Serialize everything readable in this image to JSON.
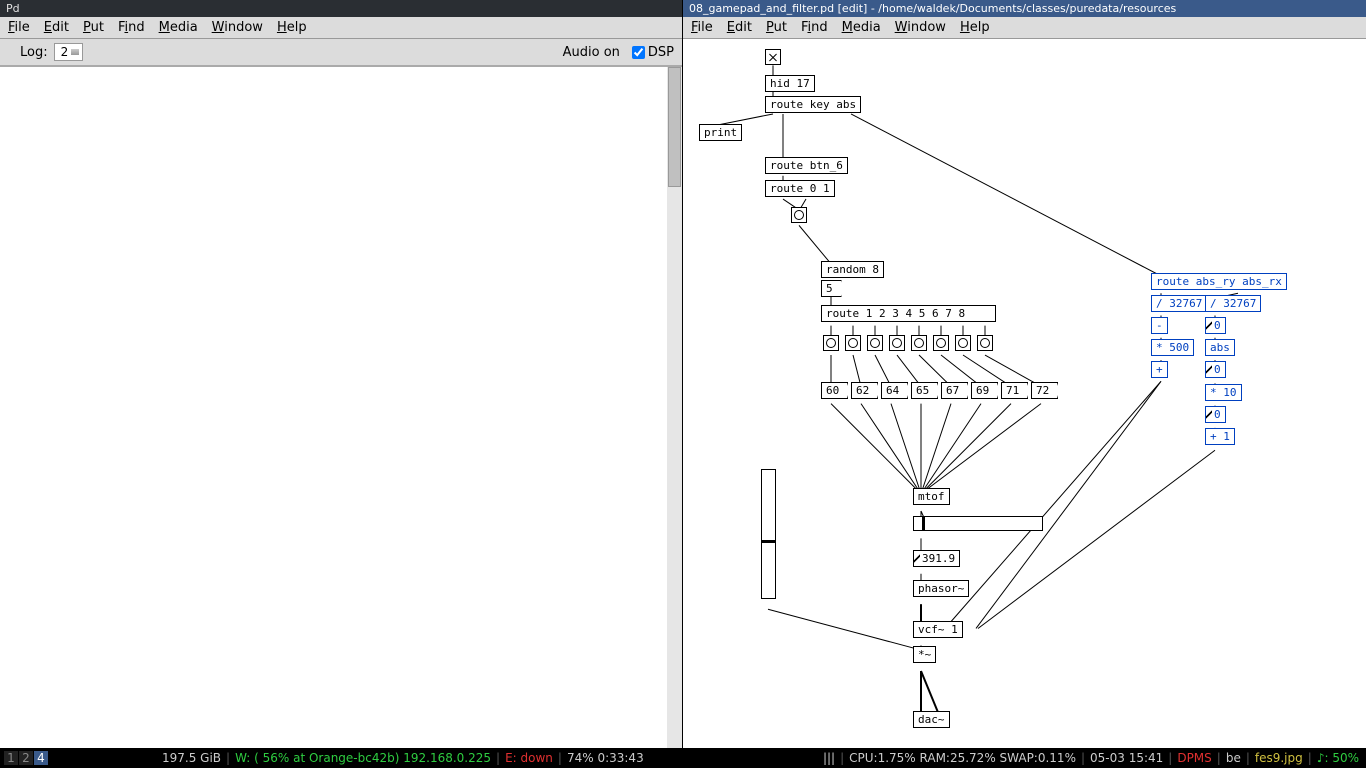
{
  "left_window": {
    "title": "Pd",
    "menu": [
      "File",
      "Edit",
      "Put",
      "Find",
      "Media",
      "Window",
      "Help"
    ],
    "log_label": "Log:",
    "log_value": "2",
    "audio_label": "Audio on",
    "dsp_label": "DSP"
  },
  "right_window": {
    "title": "08_gamepad_and_filter.pd  [edit] - /home/waldek/Documents/classes/puredata/resources",
    "menu": [
      "File",
      "Edit",
      "Put",
      "Find",
      "Media",
      "Window",
      "Help"
    ]
  },
  "patch": {
    "toggle_top": "",
    "hid": "hid 17",
    "route_key_abs": "route key abs",
    "print": "print",
    "route_btn6": "route btn_6",
    "route_01": "route 0 1",
    "random8": "random 8",
    "msg5": "5",
    "route_1to8": "route 1 2 3 4 5 6 7 8",
    "notes": [
      "60",
      "62",
      "64",
      "65",
      "67",
      "69",
      "71",
      "72"
    ],
    "mtof": "mtof",
    "freq_num": "391.9",
    "phasor": "phasor~",
    "vcf": "vcf~ 1",
    "mult_sig": "*~",
    "dac": "dac~",
    "route_abs_rxry": "route abs_ry abs_rx",
    "div_left": "/ 32767",
    "div_right": "/ 32767",
    "minus": "-",
    "zero1": "0",
    "mul500": "* 500",
    "abs_obj": "abs",
    "plus_empty": "+",
    "zero2": "0",
    "mul10": "* 10",
    "zero3": "0",
    "plus1": "+ 1"
  },
  "statusbar": {
    "workspaces": [
      "1",
      "2",
      "4"
    ],
    "active_ws": "4",
    "disk": "197.5 GiB",
    "wifi": "W: (  56% at Orange-bc42b) 192.168.0.225",
    "eth": "E:  down",
    "battery": "74% 0:33:43",
    "bars": "|||",
    "cpu": "CPU:1.75% RAM:25.72% SWAP:0.11%",
    "date": "05-03 15:41",
    "dpms": "DPMS",
    "kb": "be",
    "img": "fes9.jpg",
    "vol": "♪:  50%"
  }
}
